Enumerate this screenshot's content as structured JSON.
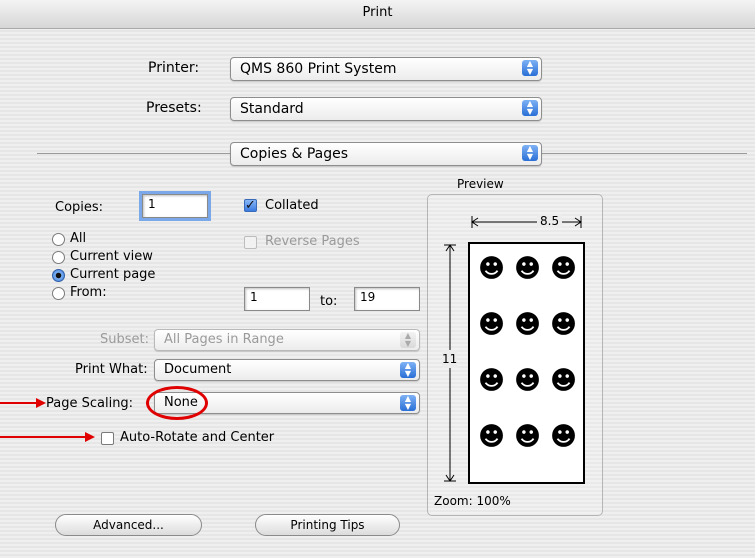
{
  "window": {
    "title": "Print"
  },
  "printer": {
    "label": "Printer:",
    "value": "QMS 860 Print System"
  },
  "presets": {
    "label": "Presets:",
    "value": "Standard"
  },
  "panel": {
    "value": "Copies & Pages"
  },
  "copies": {
    "label": "Copies:",
    "value": "1",
    "collated_label": "Collated",
    "collated": true,
    "reverse_label": "Reverse Pages",
    "reverse": false
  },
  "range": {
    "options": [
      {
        "label": "All",
        "selected": false
      },
      {
        "label": "Current view",
        "selected": false
      },
      {
        "label": "Current page",
        "selected": true
      },
      {
        "label": "From:",
        "selected": false
      }
    ],
    "from_value": "1",
    "to_label": "to:",
    "to_value": "19"
  },
  "subset": {
    "label": "Subset:",
    "value": "All Pages in Range"
  },
  "print_what": {
    "label": "Print What:",
    "value": "Document"
  },
  "page_scaling": {
    "label": "Page Scaling:",
    "value": "None"
  },
  "auto_rotate": {
    "label": "Auto-Rotate and Center",
    "checked": false
  },
  "preview": {
    "label": "Preview",
    "width_label": "8.5",
    "height_label": "11",
    "zoom": "Zoom: 100%"
  },
  "buttons": {
    "advanced": "Advanced...",
    "tips": "Printing Tips"
  },
  "colors": {
    "annotation": "#e00000",
    "accent": "#3a78d8"
  }
}
